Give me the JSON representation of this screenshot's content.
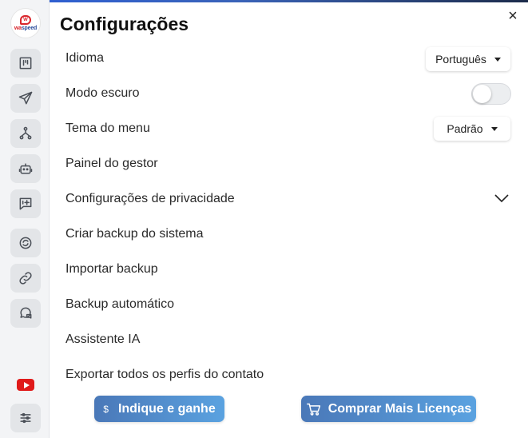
{
  "logo": {
    "bubble_text": "W",
    "brand_a": "wa",
    "brand_b": "speed"
  },
  "sidebar": {
    "items": [
      {
        "icon": "kanban-icon"
      },
      {
        "icon": "send-icon"
      },
      {
        "icon": "flow-icon"
      },
      {
        "icon": "bot-icon"
      },
      {
        "icon": "message-plus-icon"
      },
      {
        "icon": "sync-icon"
      },
      {
        "icon": "link-icon"
      },
      {
        "icon": "chat-bubbles-icon"
      }
    ],
    "bottom": [
      {
        "icon": "youtube-icon"
      },
      {
        "icon": "sliders-icon"
      }
    ]
  },
  "panel": {
    "title": "Configurações",
    "close_label": "×",
    "rows": [
      "Idioma",
      "Modo escuro",
      "Tema do menu",
      "Painel do gestor",
      "Configurações de privacidade",
      "Criar backup do sistema",
      "Importar backup",
      "Backup automático",
      "Assistente IA",
      "Exportar todos os perfis do contato"
    ],
    "language_value": "Português",
    "menu_theme_value": "Padrão",
    "dark_mode_on": false
  },
  "buttons": {
    "refer_icon": "$",
    "refer_label": "Indique e ganhe",
    "buy_label": "Comprar Mais Licenças"
  },
  "colors": {
    "accent": "#4a78b8",
    "accent_light": "#5aa2e0",
    "youtube": "#e01a1a",
    "brand_red": "#d9262c",
    "brand_blue": "#2b4c9b"
  }
}
